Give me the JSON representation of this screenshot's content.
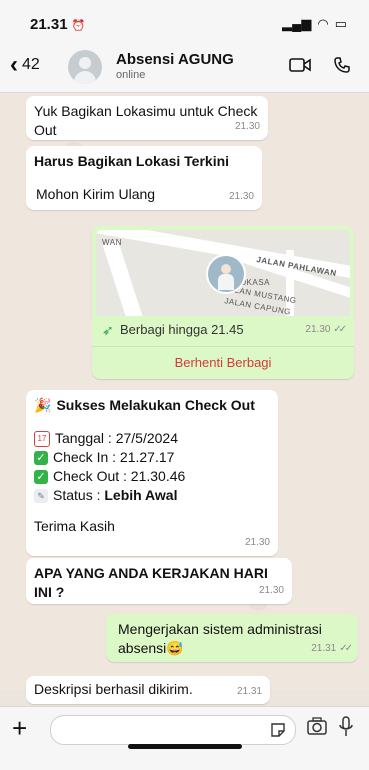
{
  "status_bar": {
    "time": "21.31",
    "alarm_icon": "alarm-icon"
  },
  "header": {
    "back_count": "42",
    "name": "Absensi AGUNG",
    "status": "online"
  },
  "messages": [
    {
      "text": "Yuk Bagikan Lokasimu untuk Check Out",
      "time": "21.30"
    },
    {
      "title": "Harus Bagikan Lokasi Terkini",
      "text": "Mohon Kirim Ulang",
      "time": "21.30"
    }
  ],
  "location": {
    "map_labels": [
      "WAN",
      "JALAN PAHLAWAN",
      "JALAN MUSTANG",
      "JALAN CAPUNG",
      "POKASA"
    ],
    "share_text": "Berbagi hingga 21.45",
    "time": "21.30",
    "stop_label": "Berhenti Berbagi"
  },
  "checkout": {
    "title": "Sukses Melakukan Check Out",
    "tanggal": "Tanggal : 27/5/2024",
    "check_in": "Check In : 21.27.17",
    "check_out": "Check Out : 21.30.46",
    "status_label": "Status : ",
    "status_value": "Lebih Awal",
    "thanks": "Terima Kasih",
    "time": "21.30"
  },
  "question": {
    "text": "APA YANG ANDA KERJAKAN HARI INI ?",
    "time": "21.30"
  },
  "reply": {
    "text": "Mengerjakan sistem administrasi absensi😅",
    "time": "21.31"
  },
  "confirm": {
    "text": "Deskripsi berhasil dikirim.",
    "time": "21.31"
  },
  "composer": {
    "placeholder": ""
  },
  "colors": {
    "incoming": "#ffffff",
    "outgoing": "#dcf8c6",
    "stop_red": "#d23b3b"
  }
}
